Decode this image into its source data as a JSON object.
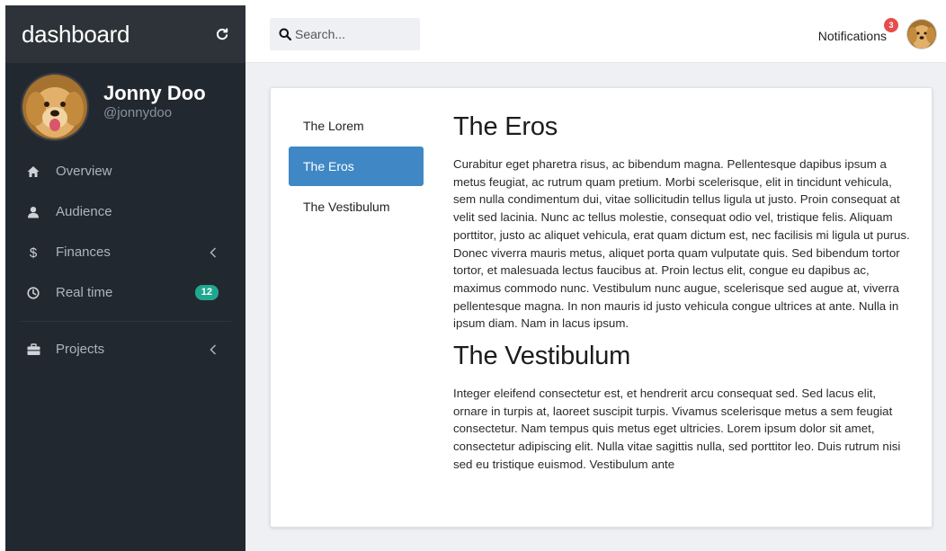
{
  "brand": {
    "title": "dashboard"
  },
  "profile": {
    "name": "Jonny Doo",
    "handle": "@jonnydoo"
  },
  "nav": {
    "overview": "Overview",
    "audience": "Audience",
    "finances": "Finances",
    "realtime": "Real time",
    "realtime_badge": "12",
    "projects": "Projects"
  },
  "search": {
    "placeholder": "Search..."
  },
  "notifications": {
    "label": "Notifications",
    "count": "3"
  },
  "tabs": [
    "The Lorem",
    "The Eros",
    "The Vestibulum"
  ],
  "active_tab": "The Eros",
  "sections": [
    {
      "heading": "The Eros",
      "body": "Curabitur eget pharetra risus, ac bibendum magna. Pellentesque dapibus ipsum a metus feugiat, ac rutrum quam pretium. Morbi scelerisque, elit in tincidunt vehicula, sem nulla condimentum dui, vitae sollicitudin tellus ligula ut justo. Proin consequat at velit sed lacinia. Nunc ac tellus molestie, consequat odio vel, tristique felis. Aliquam porttitor, justo ac aliquet vehicula, erat quam dictum est, nec facilisis mi ligula ut purus. Donec viverra mauris metus, aliquet porta quam vulputate quis. Sed bibendum tortor tortor, et malesuada lectus faucibus at. Proin lectus elit, congue eu dapibus ac, maximus commodo nunc. Vestibulum nunc augue, scelerisque sed augue at, viverra pellentesque magna. In non mauris id justo vehicula congue ultrices at ante. Nulla in ipsum diam. Nam in lacus ipsum."
    },
    {
      "heading": "The Vestibulum",
      "body": "Integer eleifend consectetur est, et hendrerit arcu consequat sed. Sed lacus elit, ornare in turpis at, laoreet suscipit turpis. Vivamus scelerisque metus a sem feugiat consectetur. Nam tempus quis metus eget ultricies. Lorem ipsum dolor sit amet, consectetur adipiscing elit. Nulla vitae sagittis nulla, sed porttitor leo. Duis rutrum nisi sed eu tristique euismod. Vestibulum ante"
    }
  ],
  "icons": {
    "refresh": "refresh-icon",
    "overview": "home-icon",
    "audience": "user-icon",
    "finances": "dollar-icon",
    "realtime": "clock-icon",
    "projects": "briefcase-icon",
    "chevron": "chevron-left-icon",
    "search": "search-icon"
  },
  "colors": {
    "sidebar": "#222830",
    "brand_bar": "#2e3339",
    "active_tab": "#3f88c5",
    "badge_teal": "#20a88f",
    "badge_red": "#e74c4c"
  }
}
